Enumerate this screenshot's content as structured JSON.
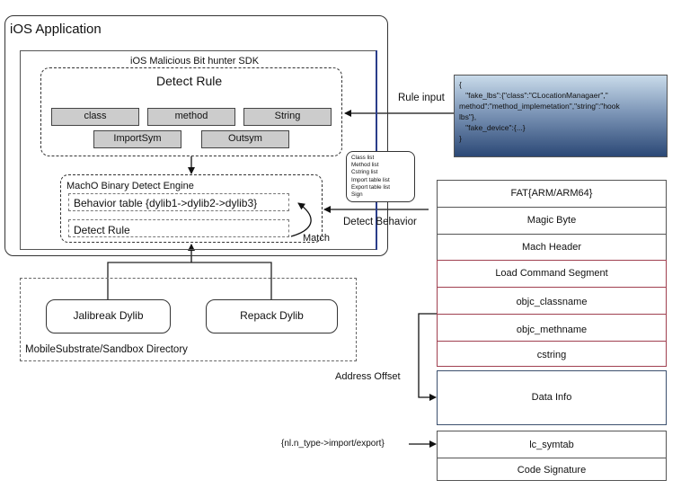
{
  "ios_app": {
    "title": "iOS Application"
  },
  "sdk": {
    "title": "iOS Malicious Bit hunter SDK"
  },
  "detect_rule": {
    "title": "Detect Rule",
    "chips": [
      "class",
      "method",
      "String",
      "ImportSym",
      "Outsym"
    ]
  },
  "engine": {
    "title": "MachO Binary Detect Engine",
    "behavior_table": "Behavior table {dylib1->dylib2->dylib3}",
    "detect_rule": "Detect Rule",
    "match_label": "Match"
  },
  "directory": {
    "title": "MobileSubstrate/Sandbox Directory",
    "dylibs": [
      "Jalibreak Dylib",
      "Repack Dylib"
    ]
  },
  "rule_input": {
    "label": "Rule input",
    "json_text": "{\n   \"fake_lbs\":{\"class\":\"CLocationManagaer\",\"\nmethod\":\"method_implemetation\",\"string\":\"hook\nlbs\"},\n   \"fake_device\":{...}\n}"
  },
  "extracted_lists": [
    "Class list",
    "Method list",
    "Cstring list",
    "Import table list",
    "Export table list",
    "Sign"
  ],
  "labels": {
    "detect_behavior": "Detect Behavior",
    "address_offset": "Address Offset",
    "symtab_note": "{nl.n_type->import/export}"
  },
  "macho_segments": [
    "FAT{ARM/ARM64}",
    "Magic Byte",
    "Mach Header",
    "Load Command Segment",
    "objc_classname",
    "objc_methname",
    "cstring",
    "Data Info",
    "lc_symtab",
    "Code Signature"
  ],
  "colors": {
    "chip_fill": "#cccccc",
    "load_command_border": "#a04050",
    "json_gradient_top": "#c9dbea",
    "json_gradient_bottom": "#2b4876"
  }
}
